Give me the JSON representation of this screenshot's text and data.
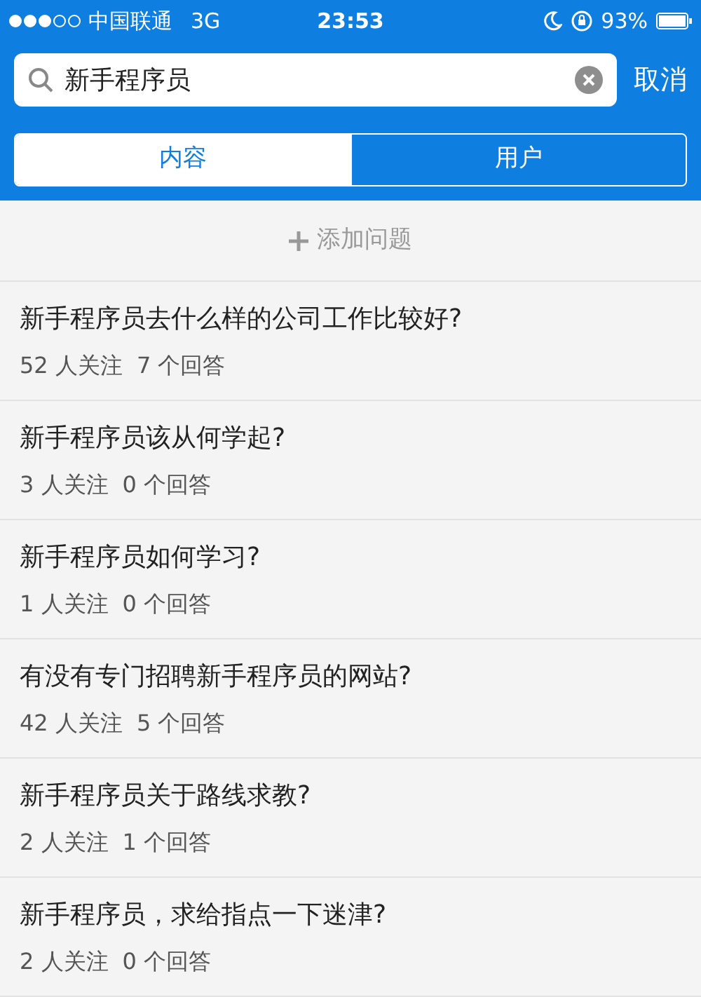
{
  "status_bar": {
    "carrier": "中国联通",
    "network": "3G",
    "time": "23:53",
    "battery": "93%"
  },
  "search": {
    "value": "新手程序员",
    "cancel": "取消"
  },
  "tabs": [
    {
      "label": "内容",
      "selected": true
    },
    {
      "label": "用户",
      "selected": false
    }
  ],
  "add_question": {
    "label": "添加问题"
  },
  "questions": [
    {
      "title": "新手程序员去什么样的公司工作比较好?",
      "followers": "52 人关注",
      "answers": "7 个回答"
    },
    {
      "title": "新手程序员该从何学起?",
      "followers": "3 人关注",
      "answers": "0 个回答"
    },
    {
      "title": "新手程序员如何学习?",
      "followers": "1 人关注",
      "answers": "0 个回答"
    },
    {
      "title": "有没有专门招聘新手程序员的网站?",
      "followers": "42 人关注",
      "answers": "5 个回答"
    },
    {
      "title": "新手程序员关于路线求教?",
      "followers": "2 人关注",
      "answers": "1 个回答"
    },
    {
      "title": "新手程序员，求给指点一下迷津?",
      "followers": "2 人关注",
      "answers": "0 个回答"
    }
  ]
}
